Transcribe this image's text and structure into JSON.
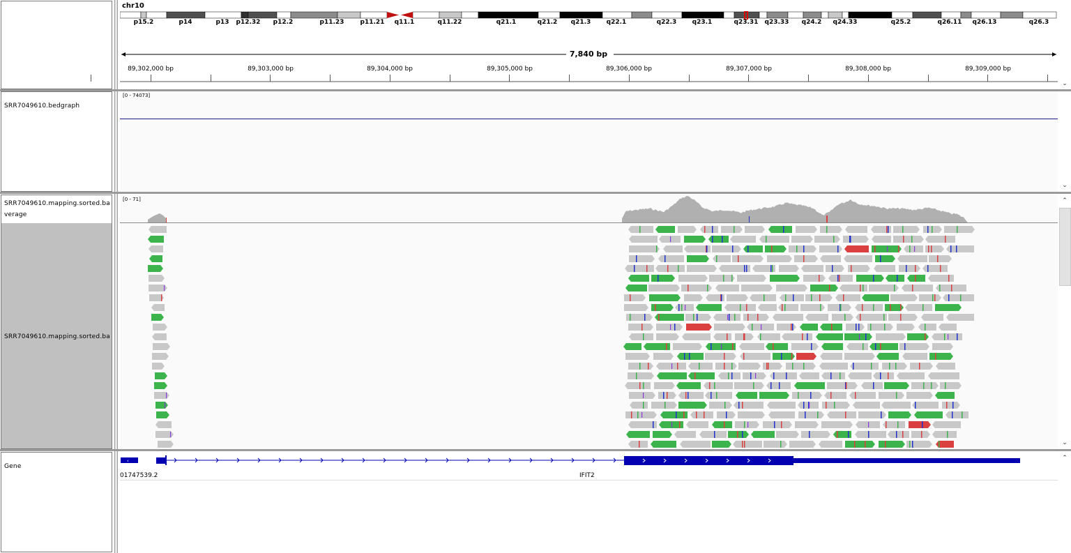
{
  "ideogram": {
    "chromosome": "chr10",
    "bands": [
      {
        "label": "p15.2"
      },
      {
        "label": "p14"
      },
      {
        "label": "p13"
      },
      {
        "label": "p12.32"
      },
      {
        "label": "p12.2"
      },
      {
        "label": "p11.23"
      },
      {
        "label": "p11.21"
      },
      {
        "label": "q11.1"
      },
      {
        "label": "q11.22"
      },
      {
        "label": "q21.1"
      },
      {
        "label": "q21.2"
      },
      {
        "label": "q21.3"
      },
      {
        "label": "q22.1"
      },
      {
        "label": "q22.3"
      },
      {
        "label": "q23.1"
      },
      {
        "label": "q23.31"
      },
      {
        "label": "q23.33"
      },
      {
        "label": "q24.2"
      },
      {
        "label": "q24.33"
      },
      {
        "label": "q25.2"
      },
      {
        "label": "q26.11"
      },
      {
        "label": "q26.13"
      },
      {
        "label": "q26.3"
      }
    ]
  },
  "ruler": {
    "span": "7,840 bp",
    "ticks": [
      "89,302,000 bp",
      "89,303,000 bp",
      "89,304,000 bp",
      "89,305,000 bp",
      "89,306,000 bp",
      "89,307,000 bp",
      "89,308,000 bp",
      "89,309,000 bp"
    ]
  },
  "tracks": {
    "bedgraph": {
      "name": "SRR7049610.bedgraph",
      "range": "[0 - 74073]"
    },
    "coverage": {
      "name_line1": "SRR7049610.mapping.sorted.ba",
      "name_line2": "verage",
      "range": "[0 - 71]"
    },
    "alignments": {
      "name": "SRR7049610.mapping.sorted.ba"
    },
    "gene": {
      "name": "Gene",
      "feature_left": "01747539.2",
      "feature_main": "IFIT2"
    }
  },
  "colors": {
    "read_gray": "#c8c8c8",
    "mismatch_green": "#3cb44b",
    "mismatch_red": "#d94040",
    "mismatch_blue": "#2030d0",
    "insertion_purple": "#8a2be2",
    "gene_blue": "#0000b0",
    "coverage_gray": "#b0b0b0"
  }
}
